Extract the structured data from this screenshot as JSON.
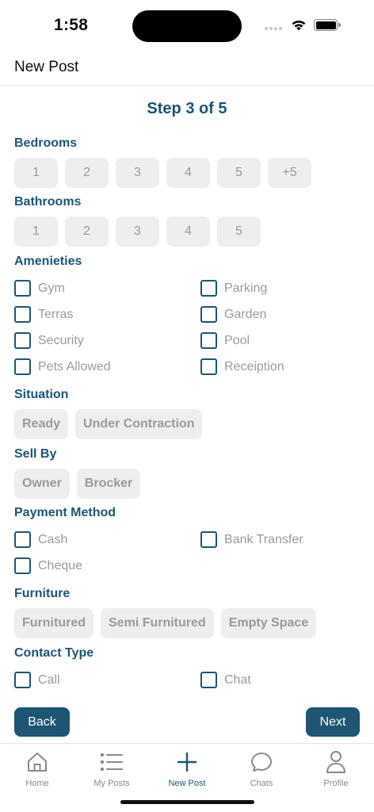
{
  "status_bar": {
    "time": "1:58"
  },
  "header": {
    "title": "New Post"
  },
  "step": {
    "title": "Step 3 of 5"
  },
  "bedrooms": {
    "label": "Bedrooms",
    "options": [
      "1",
      "2",
      "3",
      "4",
      "5",
      "+5"
    ]
  },
  "bathrooms": {
    "label": "Bathrooms",
    "options": [
      "1",
      "2",
      "3",
      "4",
      "5"
    ]
  },
  "amenities": {
    "label": "Amenieties",
    "options": [
      "Gym",
      "Parking",
      "Terras",
      "Garden",
      "Security",
      "Pool",
      "Pets Allowed",
      "Receiption"
    ]
  },
  "situation": {
    "label": "Situation",
    "options": [
      "Ready",
      "Under Contraction"
    ]
  },
  "sell_by": {
    "label": "Sell By",
    "options": [
      "Owner",
      "Brocker"
    ]
  },
  "payment_method": {
    "label": "Payment Method",
    "options": [
      "Cash",
      "Bank Transfer",
      "Cheque"
    ]
  },
  "furniture": {
    "label": "Furniture",
    "options": [
      "Furnitured",
      "Semi Furnitured",
      "Empty Space"
    ]
  },
  "contact_type": {
    "label": "Contact Type",
    "options": [
      "Call",
      "Chat"
    ]
  },
  "actions": {
    "back_label": "Back",
    "next_label": "Next"
  },
  "tabbar": {
    "tabs": [
      {
        "label": "Home",
        "icon": "home-icon"
      },
      {
        "label": "My Posts",
        "icon": "list-icon"
      },
      {
        "label": "New Post",
        "icon": "plus-icon",
        "active": true
      },
      {
        "label": "Chats",
        "icon": "chat-bubble-icon"
      },
      {
        "label": "Profile",
        "icon": "person-icon"
      }
    ]
  },
  "colors": {
    "accent": "#1e5573",
    "chip_bg": "#eeeeee",
    "muted_text": "#9a9a9a"
  }
}
